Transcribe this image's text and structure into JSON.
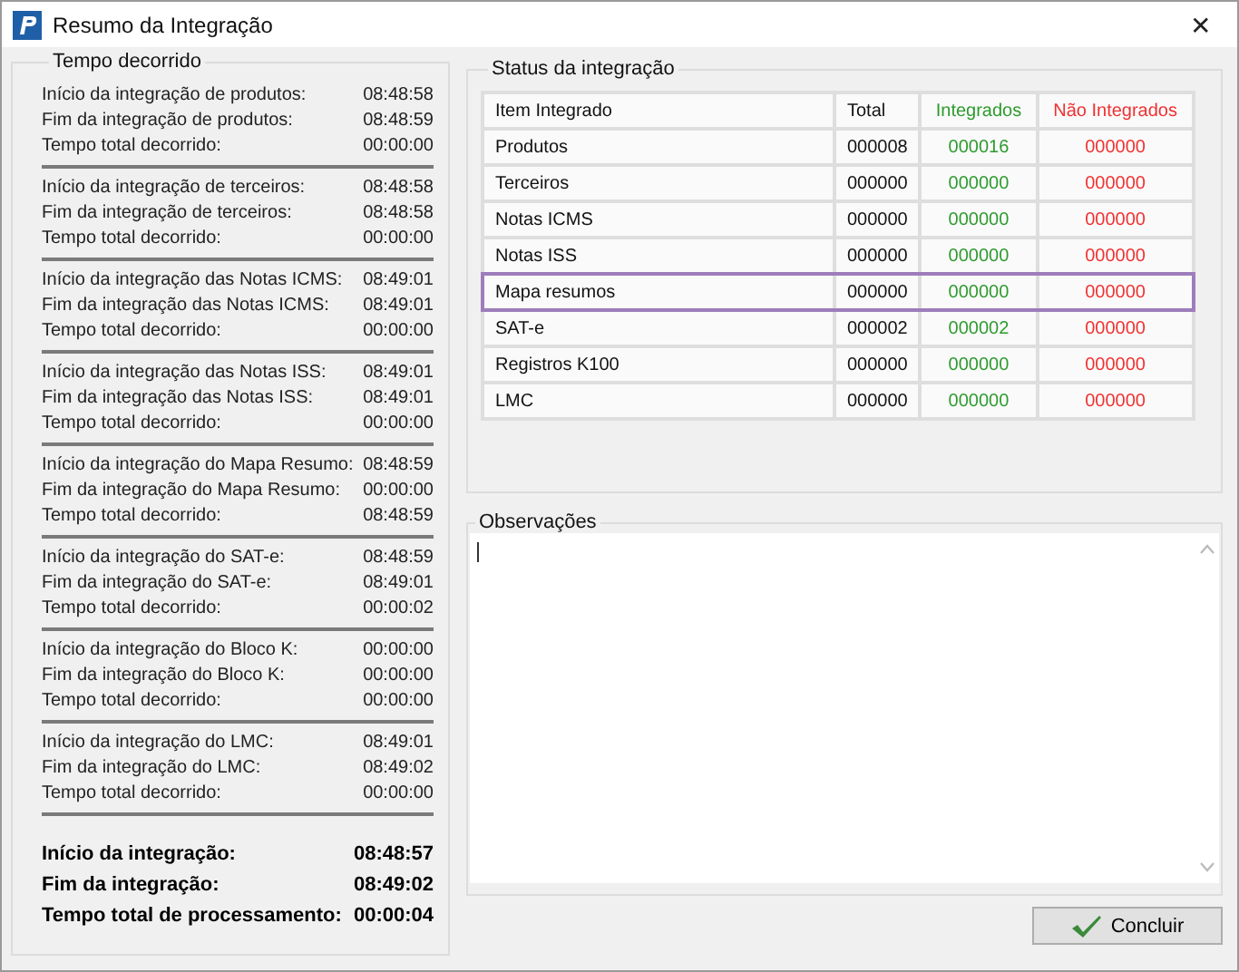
{
  "window": {
    "title": "Resumo da Integração",
    "close": "✕"
  },
  "elapsed": {
    "title": "Tempo decorrido",
    "sections": [
      {
        "rows": [
          {
            "label": "Início da integração de produtos:",
            "value": "08:48:58"
          },
          {
            "label": "Fim da integração de produtos:",
            "value": "08:48:59"
          },
          {
            "label": "Tempo total decorrido:",
            "value": "00:00:00"
          }
        ]
      },
      {
        "rows": [
          {
            "label": "Início da integração de terceiros:",
            "value": "08:48:58"
          },
          {
            "label": "Fim da integração de terceiros:",
            "value": "08:48:58"
          },
          {
            "label": "Tempo total decorrido:",
            "value": "00:00:00"
          }
        ]
      },
      {
        "rows": [
          {
            "label": "Início da integração das Notas ICMS:",
            "value": "08:49:01"
          },
          {
            "label": "Fim da integração das Notas ICMS:",
            "value": "08:49:01"
          },
          {
            "label": "Tempo total decorrido:",
            "value": "00:00:00"
          }
        ]
      },
      {
        "rows": [
          {
            "label": "Início da integração das Notas ISS:",
            "value": "08:49:01"
          },
          {
            "label": "Fim da integração das Notas ISS:",
            "value": "08:49:01"
          },
          {
            "label": "Tempo total decorrido:",
            "value": "00:00:00"
          }
        ]
      },
      {
        "rows": [
          {
            "label": "Início da integração do Mapa Resumo:",
            "value": "08:48:59"
          },
          {
            "label": "Fim da integração do Mapa Resumo:",
            "value": "00:00:00"
          },
          {
            "label": "Tempo total decorrido:",
            "value": "08:48:59"
          }
        ]
      },
      {
        "rows": [
          {
            "label": "Início da integração do SAT-e:",
            "value": "08:48:59"
          },
          {
            "label": "Fim da integração do SAT-e:",
            "value": "08:49:01"
          },
          {
            "label": "Tempo total decorrido:",
            "value": "00:00:02"
          }
        ]
      },
      {
        "rows": [
          {
            "label": "Início da integração do Bloco K:",
            "value": "00:00:00"
          },
          {
            "label": "Fim da integração do Bloco K:",
            "value": "00:00:00"
          },
          {
            "label": "Tempo total decorrido:",
            "value": "00:00:00"
          }
        ]
      },
      {
        "rows": [
          {
            "label": "Início da integração do LMC:",
            "value": "08:49:01"
          },
          {
            "label": "Fim da integração do LMC:",
            "value": "08:49:02"
          },
          {
            "label": "Tempo total decorrido:",
            "value": "00:00:00"
          }
        ]
      }
    ],
    "totals": [
      {
        "label": "Início da integração:",
        "value": "08:48:57"
      },
      {
        "label": "Fim da integração:",
        "value": "08:49:02"
      },
      {
        "label": "Tempo total de processamento:",
        "value": "00:00:04"
      }
    ]
  },
  "status": {
    "title": "Status da integração",
    "columns": [
      "Item Integrado",
      "Total",
      "Integrados",
      "Não Integrados"
    ],
    "rows": [
      {
        "item": "Produtos",
        "total": "000008",
        "integrated": "000016",
        "not_integrated": "000000",
        "selected": false
      },
      {
        "item": "Terceiros",
        "total": "000000",
        "integrated": "000000",
        "not_integrated": "000000",
        "selected": false
      },
      {
        "item": "Notas ICMS",
        "total": "000000",
        "integrated": "000000",
        "not_integrated": "000000",
        "selected": false
      },
      {
        "item": "Notas ISS",
        "total": "000000",
        "integrated": "000000",
        "not_integrated": "000000",
        "selected": false
      },
      {
        "item": "Mapa resumos",
        "total": "000000",
        "integrated": "000000",
        "not_integrated": "000000",
        "selected": true
      },
      {
        "item": "SAT-e",
        "total": "000002",
        "integrated": "000002",
        "not_integrated": "000000",
        "selected": false
      },
      {
        "item": "Registros K100",
        "total": "000000",
        "integrated": "000000",
        "not_integrated": "000000",
        "selected": false
      },
      {
        "item": "LMC",
        "total": "000000",
        "integrated": "000000",
        "not_integrated": "000000",
        "selected": false
      }
    ]
  },
  "notes": {
    "title": "Observações"
  },
  "buttons": [
    {
      "label": "Concluir"
    }
  ]
}
